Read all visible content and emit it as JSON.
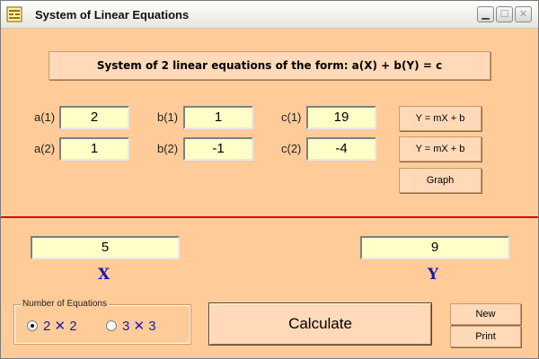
{
  "window": {
    "title": "System of Linear Equations"
  },
  "header": {
    "text": "System of 2 linear equations of the form: a(X) + b(Y) = c"
  },
  "labels": {
    "a1": "a(1)",
    "b1": "b(1)",
    "c1": "c(1)",
    "a2": "a(2)",
    "b2": "b(2)",
    "c2": "c(2)"
  },
  "values": {
    "a1": "2",
    "b1": "1",
    "c1": "19",
    "a2": "1",
    "b2": "-1",
    "c2": "-4"
  },
  "buttons": {
    "line1": "Y = mX + b",
    "line2": "Y = mX + b",
    "graph": "Graph",
    "calculate": "Calculate",
    "new": "New",
    "print": "Print"
  },
  "results": {
    "x_value": "5",
    "x_label": "X",
    "y_value": "9",
    "y_label": "Y"
  },
  "options": {
    "title": "Number of Equations",
    "opt1": "2 ✕ 2",
    "opt2": "3 ✕ 3",
    "selected": "2 ✕ 2"
  },
  "icons": {
    "app": "equation-icon",
    "minimize": "minimize-icon",
    "maximize": "maximize-icon",
    "close": "close-icon"
  },
  "colors": {
    "background": "#ffcc99",
    "field": "#ffffc8",
    "divider": "#e00000",
    "result_label": "#1a1aaa"
  }
}
